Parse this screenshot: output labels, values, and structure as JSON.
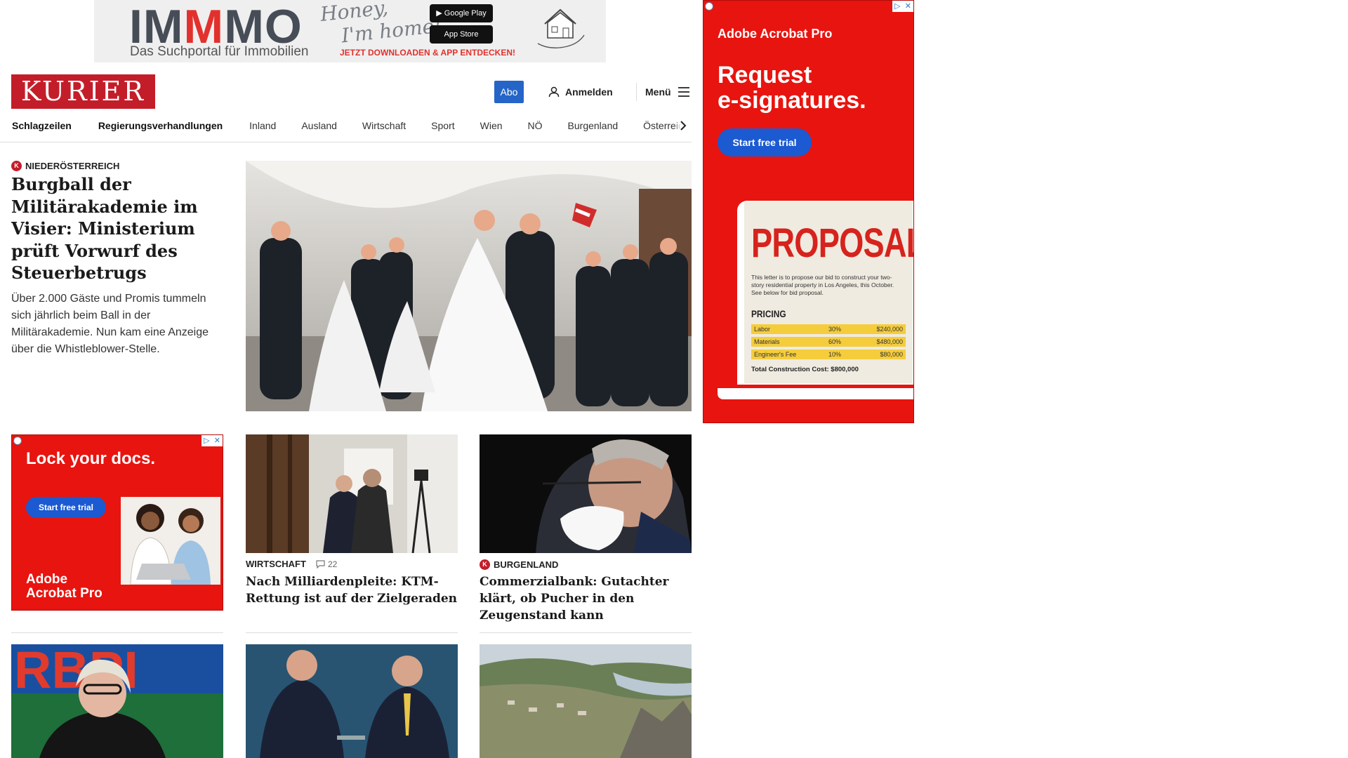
{
  "top_ad": {
    "logo_part1": "IM",
    "logo_part2": "M",
    "logo_part3": "MO",
    "tagline": "Das Suchportal für Immobilien",
    "script_line1": "Honey,",
    "script_line2": "I'm home!",
    "google_play": "Google Play",
    "app_store": "App Store",
    "cta": "JETZT DOWNLOADEN & APP ENTDECKEN!"
  },
  "header": {
    "logo": "KURIER",
    "abo": "Abo",
    "login": "Anmelden",
    "menu": "Menü"
  },
  "nav": {
    "items": [
      "Schlagzeilen",
      "Regierungsverhandlungen",
      "Inland",
      "Ausland",
      "Wirtschaft",
      "Sport",
      "Wien",
      "NÖ",
      "Burgenland",
      "Österreich"
    ]
  },
  "lead": {
    "category": "NIEDERÖSTERREICH",
    "title": "Burgball der Militärakademie im Visier: Ministerium prüft Vorwurf des Steuerbetrugs",
    "teaser": "Über 2.000 Gäste und Promis tummeln sich jährlich beim Ball in der Militärakademie. Nun kam eine Anzeige über die Whistleblower-Stelle."
  },
  "right_ad": {
    "brand": "Adobe Acrobat Pro",
    "headline_line1": "Request",
    "headline_line2": "e-signatures.",
    "button": "Start free trial",
    "doc_title": "PROPOSAL",
    "doc_text": "This letter is to propose our bid to construct your two-story residential property in Los Angeles, this October. See below for bid proposal.",
    "pricing_label": "PRICING",
    "pricing_rows": [
      {
        "item": "Labor",
        "pct": "30%",
        "amount": "$240,000"
      },
      {
        "item": "Materials",
        "pct": "60%",
        "amount": "$480,000"
      },
      {
        "item": "Engineer's Fee",
        "pct": "10%",
        "amount": "$80,000"
      }
    ],
    "total": "Total Construction Cost: $800,000"
  },
  "small_ad": {
    "headline": "Lock your docs.",
    "button": "Start free trial",
    "brand_line1": "Adobe",
    "brand_line2": "Acrobat Pro"
  },
  "cards": [
    {
      "category": "WIRTSCHAFT",
      "comments": "22",
      "title": "Nach Milliardenpleite: KTM-Rettung ist auf der Zielgeraden"
    },
    {
      "category": "BURGENLAND",
      "title": "Commerzialbank: Gutachter klärt, ob Pucher in den Zeugenstand kann"
    }
  ],
  "colors": {
    "kurier_red": "#c41d2a",
    "abo_blue": "#2565c7",
    "adobe_red": "#e8140f",
    "adobe_blue": "#1b5ad1"
  }
}
